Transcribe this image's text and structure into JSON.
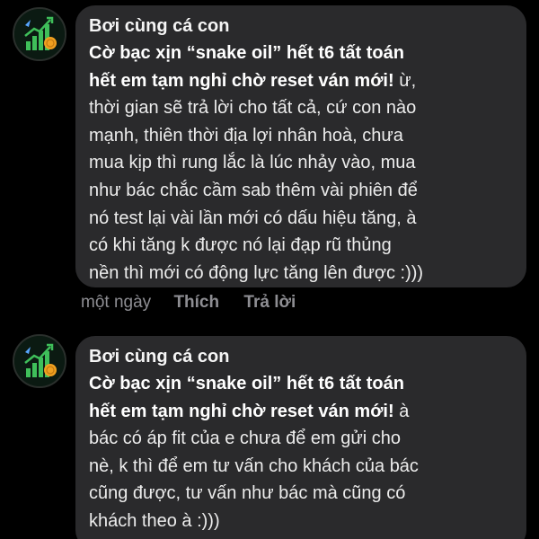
{
  "comments": [
    {
      "author": "Bơi cùng cá con",
      "lines": [
        {
          "bold": "Cờ bạc xịn  “snake oil” hết t6 tất toán",
          "rest": ""
        },
        {
          "bold": "hết em tạm nghỉ  chờ reset ván mới!",
          "rest": "  ừ,"
        },
        {
          "bold": "",
          "rest": "thời gian sẽ trả lời cho tất cả, cứ con nào"
        },
        {
          "bold": "",
          "rest": "mạnh, thiên thời địa lợi nhân hoà, chưa"
        },
        {
          "bold": "",
          "rest": "mua kịp thì rung lắc là lúc nhảy vào, mua"
        },
        {
          "bold": "",
          "rest": "như bác chắc cầm sab thêm vài phiên để"
        },
        {
          "bold": "",
          "rest": "nó test lại vài lần mới có dấu hiệu tăng, à"
        },
        {
          "bold": "",
          "rest": "có khi tăng k được nó lại đạp rũ thủng"
        },
        {
          "bold": "",
          "rest": "nền thì mới có động lực tăng lên được :)))"
        }
      ],
      "actions": {
        "time": "một ngày",
        "like": "Thích",
        "reply": "Trả lời"
      }
    },
    {
      "author": "Bơi cùng cá con",
      "lines": [
        {
          "bold": "Cờ bạc xịn  “snake oil” hết t6 tất toán",
          "rest": ""
        },
        {
          "bold": "hết em tạm nghỉ  chờ reset ván mới!",
          "rest": "  à"
        },
        {
          "bold": "",
          "rest": "bác có áp fit của e chưa để em gửi cho"
        },
        {
          "bold": "",
          "rest": "nè, k thì để em tư vấn cho khách của bác"
        },
        {
          "bold": "",
          "rest": "cũng được, tư vấn như bác mà cũng có"
        },
        {
          "bold": "",
          "rest": "khách theo à :)))"
        }
      ]
    }
  ],
  "colors": {
    "background": "#000000",
    "bubble": "#2a2a2c",
    "muted_text": "#8e8e93",
    "avatar_bars": "#3fbf5a",
    "avatar_coin": "#f0a020"
  }
}
